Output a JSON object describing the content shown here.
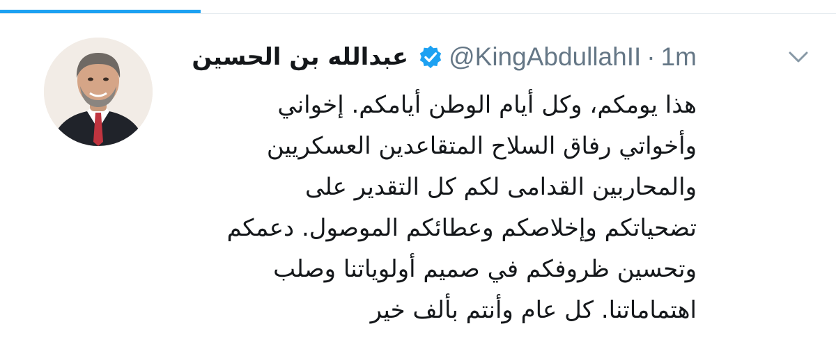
{
  "tweet": {
    "author": {
      "display_name": "عبدالله بن الحسين",
      "handle": "@KingAbdullahII",
      "verified": true,
      "avatar_icon": "profile-photo"
    },
    "separator": "·",
    "timestamp": "1m",
    "menu_icon": "chevron-down-icon",
    "lines": [
      "هذا يومكم، وكل أيام الوطن أيامكم. إخواني",
      "وأخواتي رفاق السلاح المتقاعدين العسكريين",
      "والمحاربين القدامى لكم كل التقدير على",
      "تضحياتكم وإخلاصكم وعطائكم الموصول. دعمكم",
      "وتحسين ظروفكم في صميم أولوياتنا وصلب",
      "اهتماماتنا. كل عام وأنتم بألف خير"
    ]
  },
  "colors": {
    "accent": "#1da1f2",
    "text": "#14171a",
    "muted": "#657786",
    "divider": "#e6ecf0"
  }
}
